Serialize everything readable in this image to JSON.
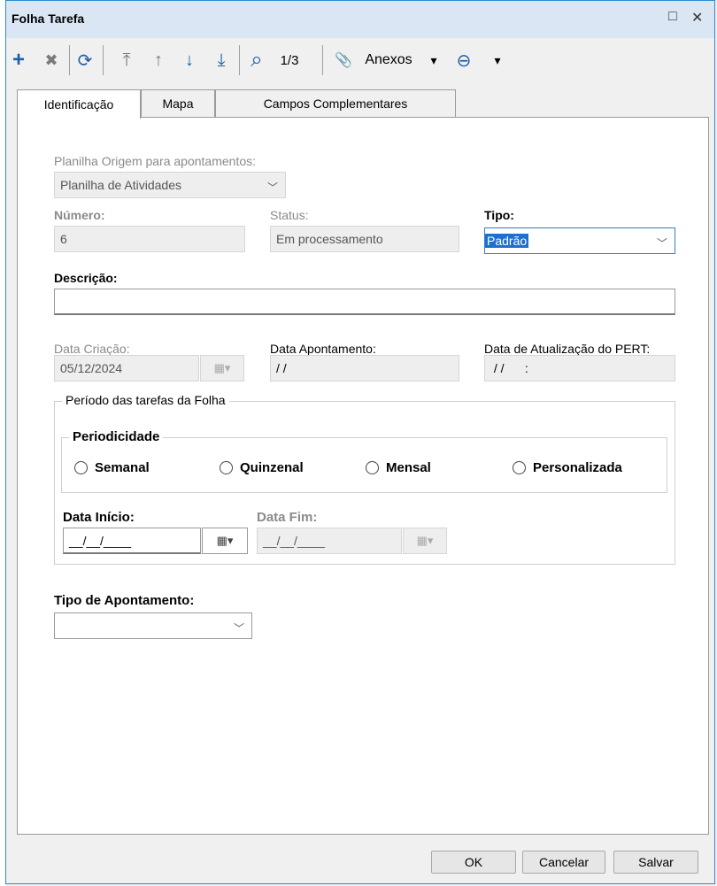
{
  "window": {
    "title": "Folha Tarefa",
    "restore_icon": "□",
    "close_icon": "✕"
  },
  "toolbar": {
    "add_icon": "+",
    "delete_icon": "✖",
    "refresh_icon": "⟳",
    "first_icon": "⤒",
    "up_icon": "↑",
    "down_icon": "↓",
    "last_icon": "⤓",
    "search_icon": "⌕",
    "page_indicator": "1/3",
    "attach_icon": "📎",
    "attachments_label": "Anexos",
    "dropdown_icon": "▾",
    "extra_icon": "⊖"
  },
  "tabs": [
    {
      "label": "Identificação",
      "active": true
    },
    {
      "label": "Mapa",
      "active": false
    },
    {
      "label": "Campos Complementares",
      "active": false
    }
  ],
  "form": {
    "planilha_label": "Planilha Origem para apontamentos:",
    "planilha_value": "Planilha de Atividades",
    "numero_label": "Número:",
    "numero_value": "6",
    "status_label": "Status:",
    "status_value": "Em processamento",
    "tipo_label": "Tipo:",
    "tipo_value": "Padrão",
    "descricao_label": "Descrição:",
    "descricao_value": "",
    "data_criacao_label": "Data Criação:",
    "data_criacao_value": "05/12/2024",
    "data_apontamento_label": "Data Apontamento:",
    "data_apontamento_value": " / /",
    "data_pert_label": "Data de Atualização do PERT:",
    "data_pert_value": " / /      :",
    "periodo_title": "Período das tarefas da Folha",
    "periodicidade_title": "Periodicidade",
    "radios": [
      "Semanal",
      "Quinzenal",
      "Mensal",
      "Personalizada"
    ],
    "data_inicio_label": "Data Início:",
    "data_inicio_value": "__/__/____",
    "data_fim_label": "Data Fim:",
    "data_fim_value": "__/__/____",
    "tipo_apontamento_label": "Tipo de Apontamento:",
    "tipo_apontamento_value": "",
    "calendar_icon": "▦▾",
    "chevron_icon": "﹀"
  },
  "footer": {
    "ok_label": "OK",
    "cancel_label": "Cancelar",
    "save_label": "Salvar"
  }
}
